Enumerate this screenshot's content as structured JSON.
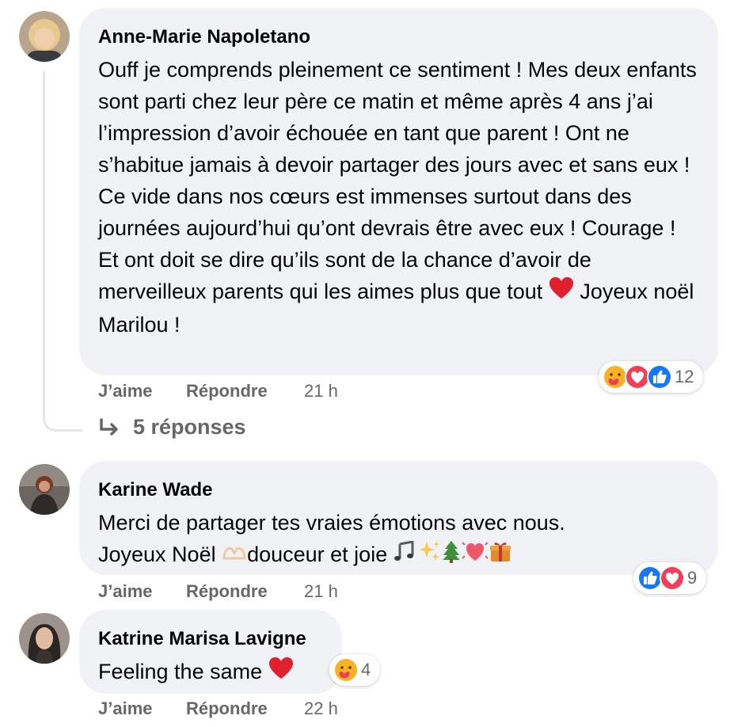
{
  "comments": [
    {
      "author": "Anne-Marie Napoletano",
      "text": "Ouff je comprends pleinement ce sentiment ! Mes deux enfants sont parti chez leur père ce matin et même après 4 ans j’ai l’impression d’avoir échouée en tant que parent ! Ont ne s’habitue jamais à devoir partager des jours avec et sans eux ! Ce vide dans nos cœurs est immenses surtout dans des journées aujourd’hui qu’ont devrais être avec eux ! Courage ! Et ont doit se dire qu’ils sont de la chance d’avoir de merveilleux parents qui les aimes plus que tout",
      "text_end": " Joyeux noël Marilou !",
      "reactions": [
        "care",
        "love",
        "like"
      ],
      "reaction_count": "12",
      "like_label": "J’aime",
      "reply_label": "Répondre",
      "time": "21 h",
      "replies_label": "5 réponses"
    },
    {
      "author": "Karine Wade",
      "text_line1": "Merci de partager tes vraies émotions avec nous.",
      "text_line2a": "Joyeux Noël ",
      "text_line2b": "douceur et joie ",
      "emojis": [
        "hands-icon",
        "music-notes-icon",
        "sparkles-icon",
        "christmas-tree-icon",
        "beating-heart-icon",
        "gift-icon"
      ],
      "reactions": [
        "like",
        "love"
      ],
      "reaction_count": "9",
      "like_label": "J’aime",
      "reply_label": "Répondre",
      "time": "21 h"
    },
    {
      "author": "Katrine Marisa Lavigne",
      "text": "Feeling the same ",
      "reactions": [
        "care"
      ],
      "reaction_count": "4",
      "like_label": "J’aime",
      "reply_label": "Répondre",
      "time": "22 h"
    }
  ],
  "colors": {
    "bubble": "#f0f2f5",
    "meta": "#65676b",
    "like_blue": "#1877f2",
    "love_red": "#f33e58",
    "care_yellow": "#f7b125"
  }
}
